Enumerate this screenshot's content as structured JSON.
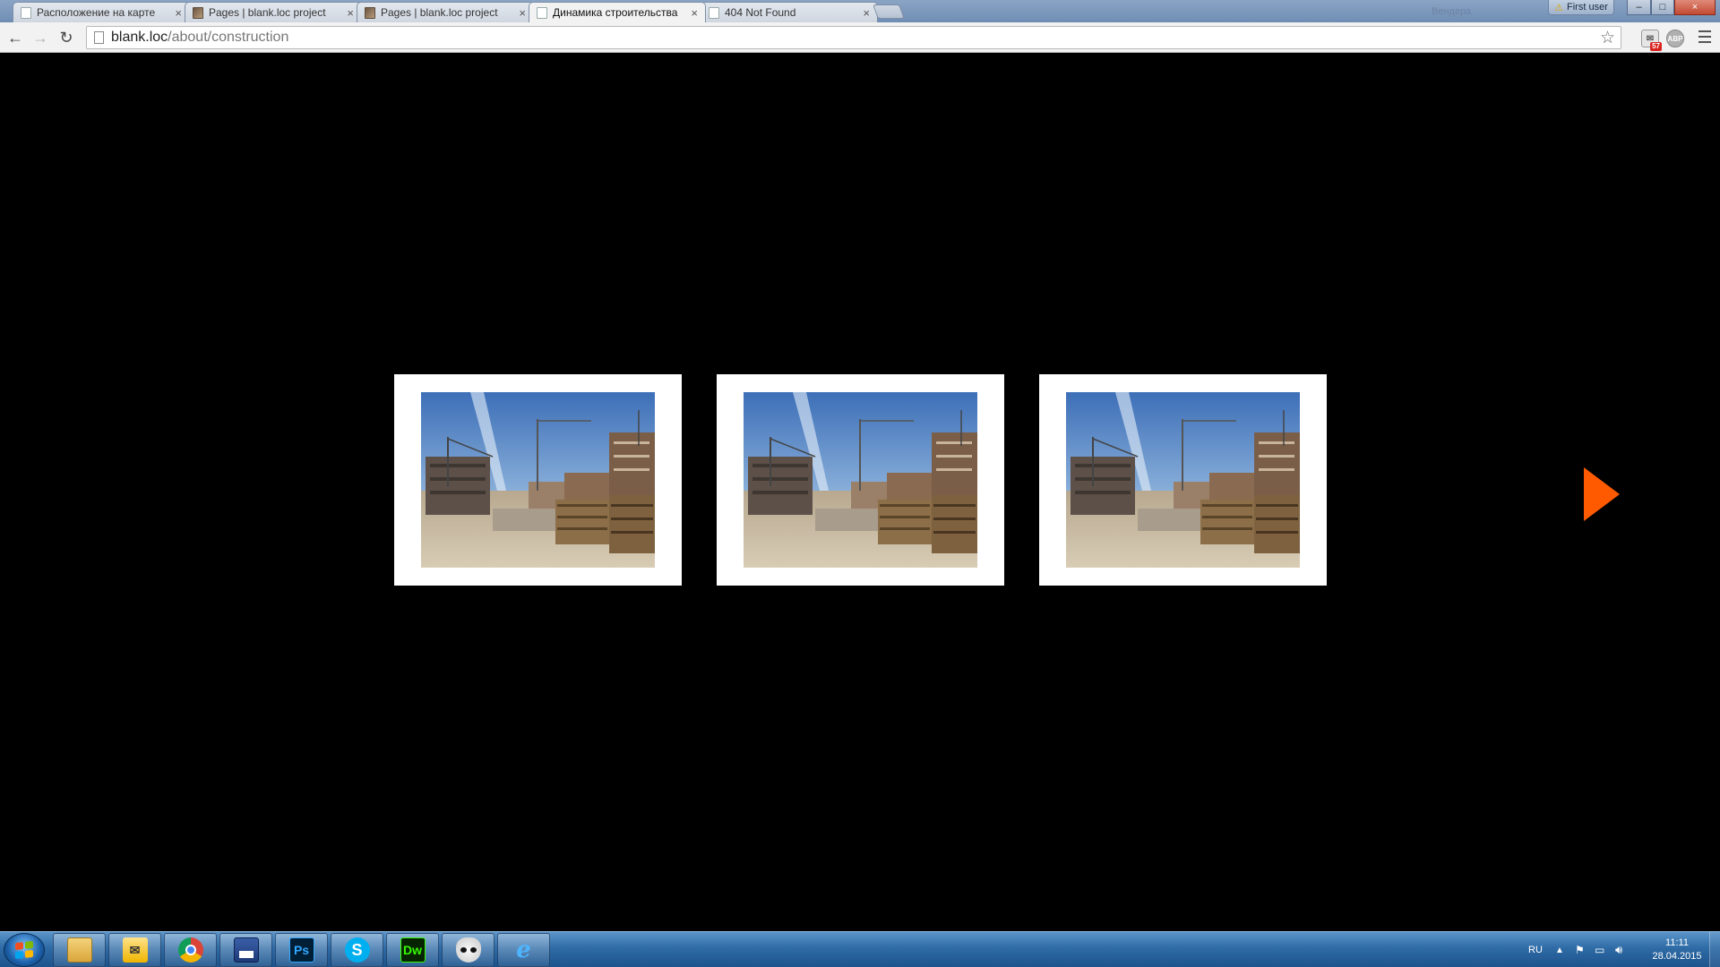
{
  "browser": {
    "tabs": [
      {
        "title": "Расположение на карте",
        "favicon": "page-icon"
      },
      {
        "title": "Pages | blank.loc project",
        "favicon": "site-image-icon"
      },
      {
        "title": "Pages | blank.loc project",
        "favicon": "site-image-icon"
      },
      {
        "title": "Динамика строительства",
        "favicon": "page-icon",
        "active": true
      },
      {
        "title": "404 Not Found",
        "favicon": "page-icon"
      }
    ],
    "tab_close_glyph": "×",
    "profile_blurred": "Вендера",
    "profile_button": "First user",
    "window_buttons": {
      "minimize": "–",
      "maximize": "□",
      "close": "×"
    },
    "address": {
      "host": "blank.loc",
      "path": "/about/construction"
    },
    "nav": {
      "back": "←",
      "forward": "→",
      "reload": "↻",
      "bookmark": "☆"
    },
    "extensions": {
      "mail_badge": "57",
      "abp": "ABP"
    }
  },
  "gallery": {
    "photos": [
      {
        "alt": "construction site with cranes"
      },
      {
        "alt": "construction site with cranes"
      },
      {
        "alt": "construction site with cranes"
      }
    ],
    "next_color": "#ff5a00"
  },
  "taskbar": {
    "apps": [
      {
        "name": "explorer",
        "label": ""
      },
      {
        "name": "outlook",
        "label": ""
      },
      {
        "name": "chrome",
        "label": ""
      },
      {
        "name": "save-utility",
        "label": ""
      },
      {
        "name": "photoshop",
        "label": "Ps"
      },
      {
        "name": "skype",
        "label": "S"
      },
      {
        "name": "dreamweaver",
        "label": "Dw"
      },
      {
        "name": "foobar",
        "label": ""
      },
      {
        "name": "internet-explorer",
        "label": "e"
      }
    ],
    "language": "RU",
    "time": "11:11",
    "date": "28.04.2015"
  }
}
